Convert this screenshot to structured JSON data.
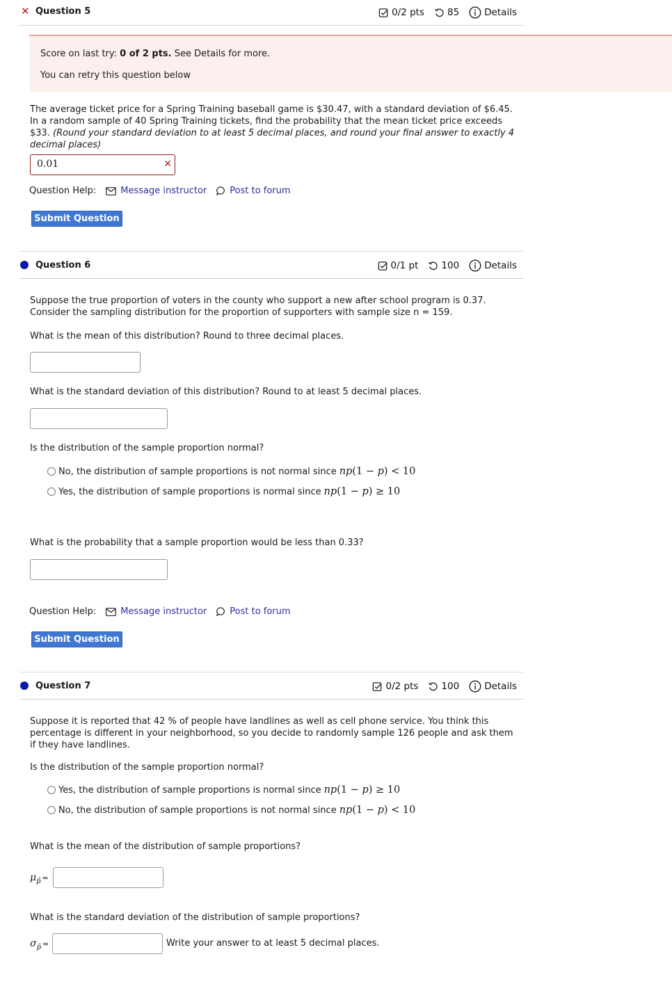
{
  "q5": {
    "title": "Question 5",
    "status_icon": "x-mark-icon",
    "score": "0/2 pts",
    "attempts": "85",
    "details_label": "Details",
    "banner": {
      "score_prefix": "Score on last try: ",
      "score_bold": "0 of 2 pts.",
      "score_suffix": " See Details for more.",
      "retry_text": "You can retry this question below"
    },
    "prompt_plain": "The average ticket price for a Spring Training baseball game is $30.47, with a standard deviation of $6.45. In a random sample of 40 Spring Training tickets, find the probability that the mean ticket price exceeds $33. ",
    "prompt_italic": "(Round your standard deviation to at least 5 decimal places, and round your final answer to exactly 4 decimal places)",
    "answer_value": "0.01",
    "help_label": "Question Help:",
    "message_label": "Message instructor",
    "forum_label": "Post to forum",
    "submit_label": "Submit Question"
  },
  "q6": {
    "title": "Question 6",
    "score": "0/1 pt",
    "attempts": "100",
    "details_label": "Details",
    "prompt_line1": "Suppose the true proportion of voters in the county who support a new after school program is 0.37.",
    "prompt_line2": "Consider the sampling distribution for the proportion of supporters with sample size n = 159.",
    "mean_question": "What is the mean of this distribution?  Round to three decimal places.",
    "mean_value": "",
    "sd_question": "What is the standard deviation of this distribution?  Round to at least 5 decimal places.",
    "sd_value": "",
    "normal_question": "Is the distribution of the sample proportion normal?",
    "options": [
      {
        "text": "No, the distribution of sample proportions is not normal since ",
        "math_var": "np",
        "math_rest": "(1 − ",
        "math_p": "p",
        "math_tail": ") < 10",
        "selected": false
      },
      {
        "text": "Yes, the distribution of sample proportions is normal since ",
        "math_var": "np",
        "math_rest": "(1 − ",
        "math_p": "p",
        "math_tail": ") ≥ 10",
        "selected": false
      }
    ],
    "prob_question": "What is the probability that a sample proportion would be less than 0.33?",
    "prob_value": "",
    "help_label": "Question Help:",
    "message_label": "Message instructor",
    "forum_label": "Post to forum",
    "submit_label": "Submit Question"
  },
  "q7": {
    "title": "Question 7",
    "score": "0/2 pts",
    "attempts": "100",
    "details_label": "Details",
    "prompt": "Suppose it is reported that 42 % of people have landlines as well as cell phone service. You think this percentage is different in your neighborhood, so you decide to randomly sample 126 people and ask them if they have landlines.",
    "normal_question": "Is the distribution of the sample proportion normal?",
    "options": [
      {
        "text": "Yes, the distribution of sample proportions is normal since ",
        "math_var": "np",
        "math_rest": "(1 − ",
        "math_p": "p",
        "math_tail": ") ≥ 10",
        "selected": false
      },
      {
        "text": "No, the distribution of sample proportions is not normal since ",
        "math_var": "np",
        "math_rest": "(1 − ",
        "math_p": "p",
        "math_tail": ") < 10",
        "selected": false
      }
    ],
    "mean_question": "What is the mean of the distribution of sample proportions?",
    "mean_symbol": "μ",
    "mean_sub": "p̂",
    "mean_value": "",
    "sd_question": "What is the standard deviation of the distribution of sample proportions?",
    "sd_symbol": "σ",
    "sd_sub": "p̂",
    "sd_value": "",
    "sd_hint": "Write your answer to at least 5 decimal places."
  },
  "equals": "="
}
